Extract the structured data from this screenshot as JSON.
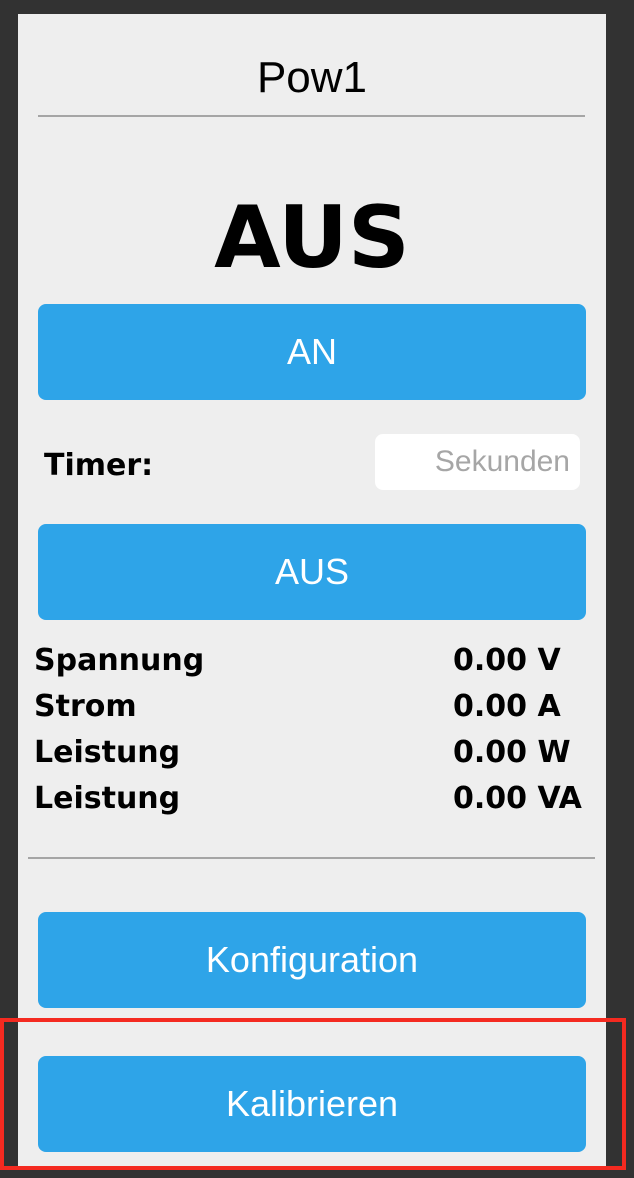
{
  "title": "Pow1",
  "status": "AUS",
  "buttons": {
    "on_label": "AN",
    "off_label": "AUS",
    "config_label": "Konfiguration",
    "calibrate_label": "Kalibrieren"
  },
  "timer": {
    "label": "Timer:",
    "value": "",
    "placeholder": "Sekunden"
  },
  "readings": [
    {
      "label": "Spannung",
      "value": "0.00 V"
    },
    {
      "label": "Strom",
      "value": "0.00 A"
    },
    {
      "label": "Leistung",
      "value": "0.00 W"
    },
    {
      "label": "Leistung",
      "value": "0.00 VA"
    }
  ],
  "colors": {
    "button": "#2ea4e8",
    "panel": "#eeeeee",
    "background": "#323232",
    "highlight": "#f42a20"
  }
}
